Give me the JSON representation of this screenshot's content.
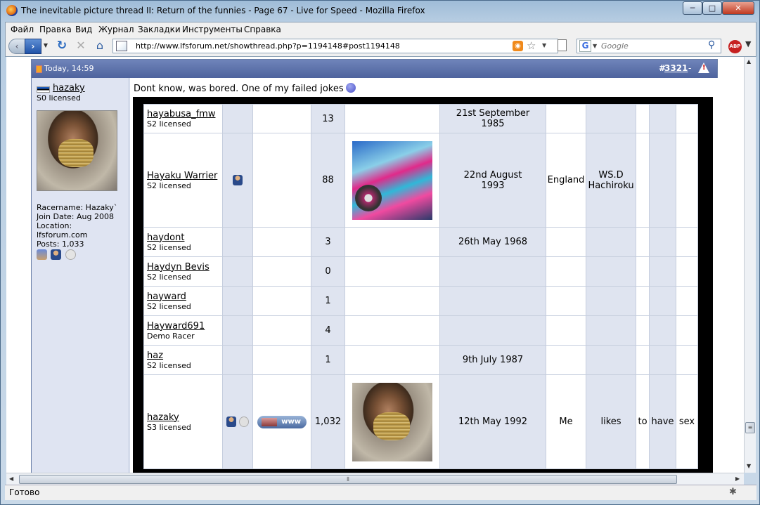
{
  "window": {
    "title": "The inevitable picture thread II: Return of the funnies - Page 67 - Live for Speed - Mozilla Firefox",
    "buttons": {
      "min": "─",
      "max": "□",
      "close": "✕"
    }
  },
  "menu": [
    "Файл",
    "Правка",
    "Вид",
    "Журнал",
    "Закладки",
    "Инструменты",
    "Справка"
  ],
  "toolbar": {
    "url": "http://www.lfsforum.net/showthread.php?p=1194148#post1194148",
    "search_engine_letter": "G",
    "search_placeholder": "Google",
    "abp_label": "ABP"
  },
  "post": {
    "date": "Today, 14:59",
    "hash": "#",
    "number": "3321",
    "dash": "-",
    "author": {
      "name": "hazaky",
      "title": "S0 licensed",
      "racername": "Racername: Hazaky`",
      "join_date": "Join Date: Aug 2008",
      "location_label": "Location:",
      "location": "lfsforum.com",
      "posts": "Posts: 1,033"
    },
    "text": "Dont know, was bored. One of my failed jokes",
    "members": [
      {
        "name": "hayabusa_fmw",
        "license": "S2 licensed",
        "icons": [],
        "www": false,
        "posts": "13",
        "image": "",
        "birthday": "21st September 1985",
        "location": "",
        "car": "",
        "c1": "",
        "c2": "",
        "c3": ""
      },
      {
        "name": "Hayaku Warrier",
        "license": "S2 licensed",
        "icons": [
          "person"
        ],
        "www": false,
        "posts": "88",
        "image": "car",
        "birthday": "22nd August 1993",
        "location": "England",
        "car": "WS.D Hachiroku",
        "c1": "",
        "c2": "",
        "c3": ""
      },
      {
        "name": "haydont",
        "license": "S2 licensed",
        "icons": [],
        "www": false,
        "posts": "3",
        "image": "",
        "birthday": "26th May 1968",
        "location": "",
        "car": "",
        "c1": "",
        "c2": "",
        "c3": ""
      },
      {
        "name": "Haydyn Bevis",
        "license": "S2 licensed",
        "icons": [],
        "www": false,
        "posts": "0",
        "image": "",
        "birthday": "",
        "location": "",
        "car": "",
        "c1": "",
        "c2": "",
        "c3": ""
      },
      {
        "name": "hayward",
        "license": "S2 licensed",
        "icons": [],
        "www": false,
        "posts": "1",
        "image": "",
        "birthday": "",
        "location": "",
        "car": "",
        "c1": "",
        "c2": "",
        "c3": ""
      },
      {
        "name": "Hayward691",
        "license": "Demo Racer",
        "icons": [],
        "www": false,
        "posts": "4",
        "image": "",
        "birthday": "",
        "location": "",
        "car": "",
        "c1": "",
        "c2": "",
        "c3": ""
      },
      {
        "name": "haz",
        "license": "S2 licensed",
        "icons": [],
        "www": false,
        "posts": "1",
        "image": "",
        "birthday": "9th July 1987",
        "location": "",
        "car": "",
        "c1": "",
        "c2": "",
        "c3": ""
      },
      {
        "name": "hazaky",
        "license": "S3 licensed",
        "icons": [
          "person",
          "offline"
        ],
        "www": true,
        "posts": "1,032",
        "image": "avatar",
        "birthday": "12th May 1992",
        "location": "Me",
        "car": "likes",
        "c1": "to",
        "c2": "have",
        "c3": "sex"
      }
    ],
    "www_label": "www"
  },
  "status": {
    "text": "Готово"
  }
}
